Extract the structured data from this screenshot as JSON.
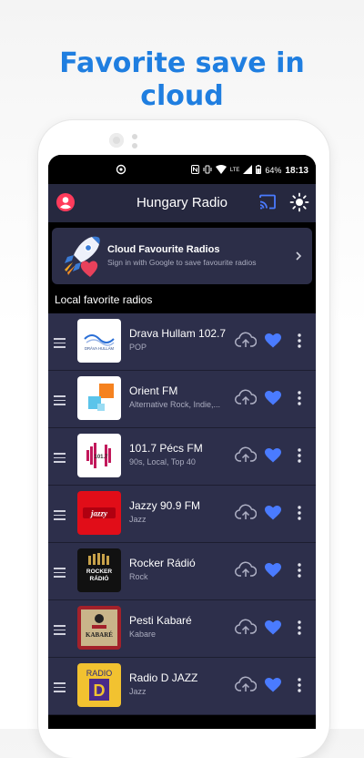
{
  "promo": {
    "line1": "Favorite save in",
    "line2": "cloud"
  },
  "status": {
    "battery": "64%",
    "time": "18:13",
    "network": "LTE"
  },
  "appbar": {
    "title": "Hungary Radio"
  },
  "cloud_card": {
    "title": "Cloud Favourite Radios",
    "subtitle": "Sign in with Google to save favourite radios"
  },
  "section_title": "Local favorite radios",
  "stations": [
    {
      "name": "Drava Hullam 102.7",
      "genre": "POP"
    },
    {
      "name": "Orient FM",
      "genre": "Alternative Rock, Indie,..."
    },
    {
      "name": "101.7 Pécs FM",
      "genre": "90s, Local, Top 40"
    },
    {
      "name": "Jazzy 90.9 FM",
      "genre": "Jazz"
    },
    {
      "name": "Rocker Rádió",
      "genre": "Rock"
    },
    {
      "name": "Pesti Kabaré",
      "genre": "Kabare"
    },
    {
      "name": "Radio D JAZZ",
      "genre": "Jazz"
    }
  ],
  "logos": {
    "drava": "DRÁVA HULLÁM",
    "pecs": "101.7",
    "jazzy": "jazzy",
    "rocker": "ROCKER RÁDIÓ",
    "kabare": "KABARÉ",
    "radiod_top": "RADIO",
    "radiod_letter": "D"
  },
  "colors": {
    "accent_blue": "#1f7ee0",
    "appbar_bg": "#26283f",
    "row_bg": "#2d2f4b",
    "heart": "#4a7bff",
    "account": "#ff3b5c"
  },
  "icons": [
    "account-icon",
    "cast-icon",
    "theme-icon",
    "rocket-icon",
    "chevron-right-icon",
    "drag-handle-icon",
    "cloud-upload-icon",
    "heart-icon",
    "more-vert-icon"
  ]
}
